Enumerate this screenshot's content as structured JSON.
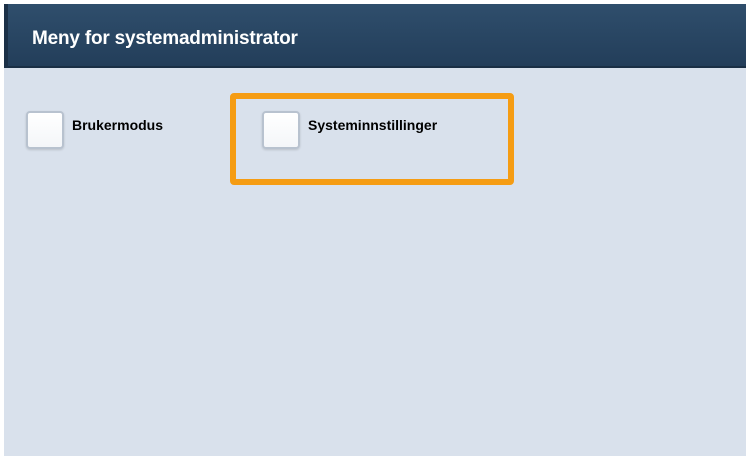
{
  "header": {
    "title": "Meny for systemadministrator"
  },
  "options": [
    {
      "label": "Brukermodus",
      "checked": false
    },
    {
      "label": "Systeminnstillinger",
      "checked": false,
      "highlighted": true
    }
  ],
  "colors": {
    "header_bg": "#2a4764",
    "screen_bg": "#d9e1ec",
    "highlight": "#f59c13"
  }
}
